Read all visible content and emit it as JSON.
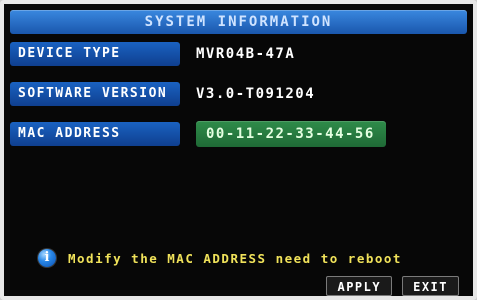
{
  "window": {
    "title": "SYSTEM INFORMATION"
  },
  "fields": [
    {
      "label": "DEVICE TYPE",
      "value": "MVR04B-47A"
    },
    {
      "label": "SOFTWARE VERSION",
      "value": "V3.0-T091204"
    },
    {
      "label": "MAC ADDRESS",
      "value": "00-11-22-33-44-56"
    }
  ],
  "notice": {
    "icon": "info-icon",
    "text": "Modify the MAC ADDRESS need to reboot"
  },
  "buttons": {
    "apply": "APPLY",
    "exit": "EXIT"
  },
  "colors": {
    "title_bar": "#2a74d0",
    "label_bg": "#1552a8",
    "mac_value_bg": "#2f8c4a",
    "notice_text": "#f0e25a",
    "screen_bg": "#070707"
  }
}
